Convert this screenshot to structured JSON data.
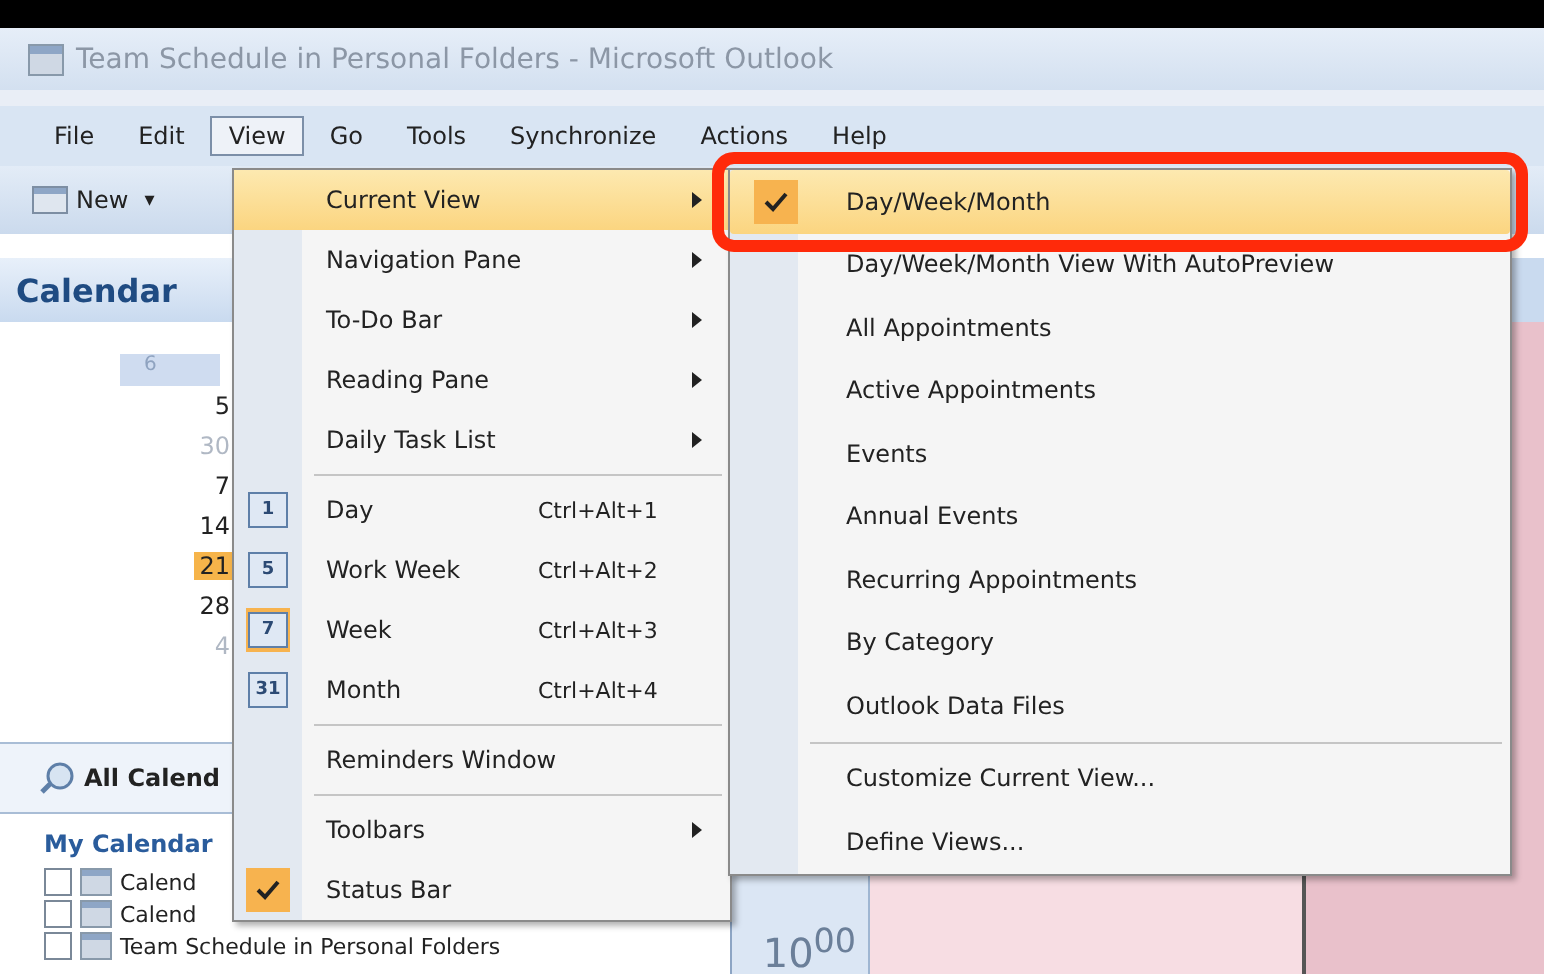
{
  "window": {
    "title": "Team Schedule in Personal Folders - Microsoft Outlook"
  },
  "menu_bar": [
    {
      "label": "File",
      "selected": false
    },
    {
      "label": "Edit",
      "selected": false
    },
    {
      "label": "View",
      "selected": true
    },
    {
      "label": "Go",
      "selected": false
    },
    {
      "label": "Tools",
      "selected": false
    },
    {
      "label": "Synchronize",
      "selected": false
    },
    {
      "label": "Actions",
      "selected": false
    },
    {
      "label": "Help",
      "selected": false
    }
  ],
  "toolbar": {
    "new_button": "New",
    "dropdown": "▾"
  },
  "sidebar": {
    "title": "Calendar",
    "mini_calendar": {
      "week_header": "6",
      "days": [
        {
          "text": "5",
          "selected": false,
          "faint": false
        },
        {
          "text": "30",
          "selected": false,
          "faint": true
        },
        {
          "text": "7",
          "selected": false,
          "faint": false
        },
        {
          "text": "14",
          "selected": false,
          "faint": false
        },
        {
          "text": "21",
          "selected": true,
          "faint": false
        },
        {
          "text": "28",
          "selected": false,
          "faint": false
        },
        {
          "text": "4",
          "selected": false,
          "faint": true
        }
      ]
    },
    "all_calendars": "All Calend",
    "my_calendars": "My Calendar",
    "calendars": [
      {
        "label": "Calend",
        "checked": false
      },
      {
        "label": "Calend",
        "checked": false
      },
      {
        "label": "Team Schedule in Personal Folders",
        "checked": false
      }
    ]
  },
  "calendar_view": {
    "time_label": "10$^{00}$"
  },
  "view_menu": {
    "groups": [
      [
        {
          "label": "Current View",
          "has_submenu": true,
          "checked": false,
          "selected": true
        },
        {
          "label": "Navigation Pane",
          "has_submenu": true,
          "checked": false,
          "selected": false
        },
        {
          "label": "To-Do Bar",
          "has_submenu": true,
          "checked": false,
          "selected": false
        },
        {
          "label": "Reading Pane",
          "has_submenu": true,
          "checked": false,
          "selected": false
        },
        {
          "label": "Daily Task List",
          "has_submenu": true,
          "checked": false,
          "selected": false
        }
      ],
      [
        {
          "label": "Day",
          "icon_text": "1",
          "shortcut": "Ctrl+Alt+1",
          "has_submenu": false,
          "checked": false,
          "selected": false
        },
        {
          "label": "Work Week",
          "icon_text": "5",
          "shortcut": "Ctrl+Alt+2",
          "has_submenu": false,
          "checked": false,
          "selected": false
        },
        {
          "label": "Week",
          "icon_text": "7",
          "shortcut": "Ctrl+Alt+3",
          "has_submenu": false,
          "checked": true,
          "selected": false
        },
        {
          "label": "Month",
          "icon_text": "31",
          "shortcut": "Ctrl+Alt+4",
          "has_submenu": false,
          "checked": false,
          "selected": false
        }
      ],
      [
        {
          "label": "Reminders Window",
          "has_submenu": false,
          "checked": false,
          "selected": false
        }
      ],
      [
        {
          "label": "Toolbars",
          "has_submenu": true,
          "checked": false,
          "selected": false
        },
        {
          "label": "Status Bar",
          "has_submenu": false,
          "checked": true,
          "selected": false
        }
      ]
    ]
  },
  "current_view_menu": {
    "groups": [
      [
        {
          "label": "Day/Week/Month",
          "checked": true,
          "selected": true,
          "highlighted": true
        },
        {
          "label": "Day/Week/Month View With AutoPreview",
          "checked": false,
          "selected": false,
          "highlighted": false
        },
        {
          "label": "All Appointments",
          "checked": false,
          "selected": false,
          "highlighted": false
        },
        {
          "label": "Active Appointments",
          "checked": false,
          "selected": false,
          "highlighted": false
        },
        {
          "label": "Events",
          "checked": false,
          "selected": false,
          "highlighted": false
        },
        {
          "label": "Annual Events",
          "checked": false,
          "selected": false,
          "highlighted": false
        },
        {
          "label": "Recurring Appointments",
          "checked": false,
          "selected": false,
          "highlighted": false
        },
        {
          "label": "By Category",
          "checked": false,
          "selected": false,
          "highlighted": false
        },
        {
          "label": "Outlook Data Files",
          "checked": false,
          "selected": false,
          "highlighted": false
        }
      ],
      [
        {
          "label": "Customize Current View...",
          "checked": false,
          "selected": false,
          "highlighted": false
        },
        {
          "label": "Define Views...",
          "checked": false,
          "selected": false,
          "highlighted": false
        }
      ]
    ]
  }
}
